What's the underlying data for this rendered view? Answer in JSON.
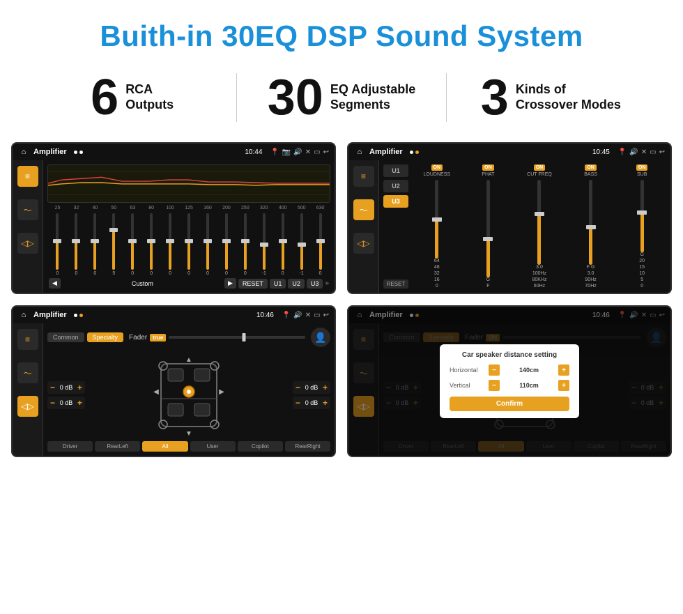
{
  "header": {
    "title": "Buith-in 30EQ DSP Sound System"
  },
  "stats": [
    {
      "number": "6",
      "label": "RCA",
      "sublabel": "Outputs"
    },
    {
      "number": "30",
      "label": "EQ Adjustable",
      "sublabel": "Segments"
    },
    {
      "number": "3",
      "label": "Kinds of",
      "sublabel": "Crossover Modes"
    }
  ],
  "screens": [
    {
      "title": "Amplifier",
      "time": "10:44",
      "type": "eq"
    },
    {
      "title": "Amplifier",
      "time": "10:45",
      "type": "crossover"
    },
    {
      "title": "Amplifier",
      "time": "10:46",
      "type": "fader"
    },
    {
      "title": "Amplifier",
      "time": "10:46",
      "type": "fader-dialog"
    }
  ],
  "eq": {
    "freqs": [
      "25",
      "32",
      "40",
      "50",
      "63",
      "80",
      "100",
      "125",
      "160",
      "200",
      "250",
      "320",
      "400",
      "500",
      "630"
    ],
    "values": [
      0,
      0,
      0,
      5,
      0,
      0,
      0,
      0,
      0,
      0,
      0,
      -1,
      0,
      -1,
      0
    ],
    "preset": "Custom",
    "presets": [
      "RESET",
      "U1",
      "U2",
      "U3"
    ]
  },
  "crossover": {
    "units": [
      "U1",
      "U2",
      "U3"
    ],
    "channels": [
      {
        "name": "LOUDNESS",
        "on": true
      },
      {
        "name": "PHAT",
        "on": true
      },
      {
        "name": "CUT FREQ",
        "on": true
      },
      {
        "name": "BASS",
        "on": true
      },
      {
        "name": "SUB",
        "on": true
      }
    ]
  },
  "fader": {
    "tabs": [
      "Common",
      "Specialty"
    ],
    "label": "Fader",
    "on": true,
    "volumes": [
      {
        "label": "0 dB"
      },
      {
        "label": "0 dB"
      },
      {
        "label": "0 dB"
      },
      {
        "label": "0 dB"
      }
    ],
    "buttons": [
      "Driver",
      "RearLeft",
      "All",
      "User",
      "Copilot",
      "RearRight"
    ]
  },
  "dialog": {
    "title": "Car speaker distance setting",
    "horizontal_label": "Horizontal",
    "horizontal_value": "140cm",
    "vertical_label": "Vertical",
    "vertical_value": "110cm",
    "confirm_label": "Confirm"
  }
}
